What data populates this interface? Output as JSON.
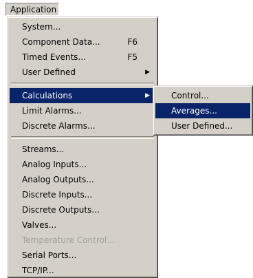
{
  "menubar": {
    "title": "Application"
  },
  "main_menu": {
    "groups": [
      [
        {
          "label": "System...",
          "shortcut": "",
          "submenu": false,
          "disabled": false
        },
        {
          "label": "Component Data...",
          "shortcut": "F6",
          "submenu": false,
          "disabled": false
        },
        {
          "label": "Timed Events...",
          "shortcut": "F5",
          "submenu": false,
          "disabled": false
        },
        {
          "label": "User Defined",
          "shortcut": "",
          "submenu": true,
          "disabled": false
        }
      ],
      [
        {
          "label": "Calculations",
          "shortcut": "",
          "submenu": true,
          "disabled": false,
          "selected": true
        },
        {
          "label": "Limit Alarms...",
          "shortcut": "",
          "submenu": false,
          "disabled": false
        },
        {
          "label": "Discrete Alarms...",
          "shortcut": "",
          "submenu": false,
          "disabled": false
        }
      ],
      [
        {
          "label": "Streams...",
          "shortcut": "",
          "submenu": false,
          "disabled": false
        },
        {
          "label": "Analog Inputs...",
          "shortcut": "",
          "submenu": false,
          "disabled": false
        },
        {
          "label": "Analog Outputs...",
          "shortcut": "",
          "submenu": false,
          "disabled": false
        },
        {
          "label": "Discrete Inputs...",
          "shortcut": "",
          "submenu": false,
          "disabled": false
        },
        {
          "label": "Discrete Outputs...",
          "shortcut": "",
          "submenu": false,
          "disabled": false
        },
        {
          "label": "Valves...",
          "shortcut": "",
          "submenu": false,
          "disabled": false
        },
        {
          "label": "Temperature Control...",
          "shortcut": "",
          "submenu": false,
          "disabled": true
        },
        {
          "label": "Serial Ports...",
          "shortcut": "",
          "submenu": false,
          "disabled": false
        },
        {
          "label": "TCP/IP...",
          "shortcut": "",
          "submenu": false,
          "disabled": false
        }
      ]
    ]
  },
  "sub_menu": {
    "items": [
      {
        "label": "Control...",
        "selected": false
      },
      {
        "label": "Averages...",
        "selected": true
      },
      {
        "label": "User Defined...",
        "selected": false
      }
    ]
  },
  "colors": {
    "menu_bg": "#d4d0c8",
    "highlight": "#0a246a",
    "disabled_text": "#a0a0a0"
  },
  "icons": {
    "submenu_arrow": "triangle-right-icon",
    "arrow_glyph": "▶"
  }
}
